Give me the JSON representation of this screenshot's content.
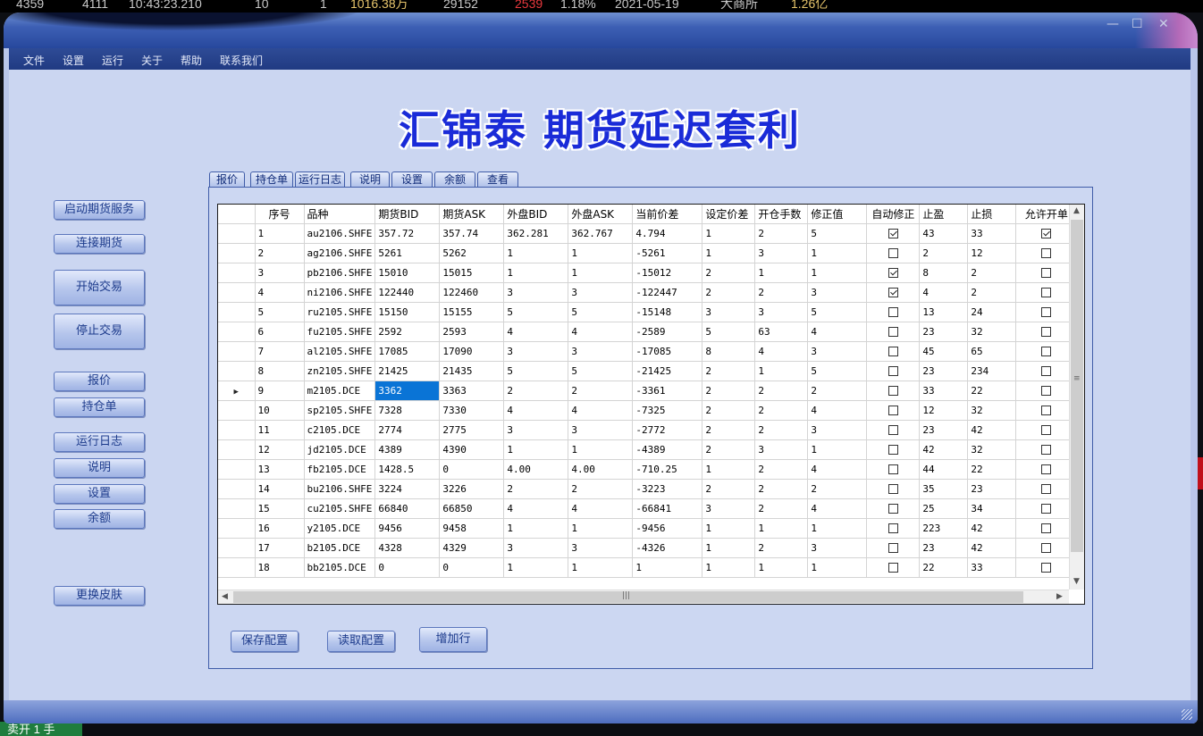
{
  "ticker": [
    "4359",
    "4111",
    "10:43:23.210",
    "10",
    "1",
    "1016.38万",
    "29152",
    "2539",
    "1.18%",
    "2021-05-19",
    "大商所",
    "1.26亿"
  ],
  "bottom_left_text": "卖开 1 手",
  "window": {
    "controls": {
      "minimize": "—",
      "maximize": "☐",
      "close": "✕"
    }
  },
  "menu": [
    "文件",
    "设置",
    "运行",
    "关于",
    "帮助",
    "联系我们"
  ],
  "app_title": "汇锦泰  期货延迟套利",
  "side_buttons": {
    "start_service": "启动期货服务",
    "connect": "连接期货",
    "start_trade": "开始交易",
    "stop_trade": "停止交易",
    "quote": "报价",
    "positions": "持仓单",
    "log": "运行日志",
    "about": "说明",
    "settings": "设置",
    "balance": "余额",
    "skin": "更换皮肤"
  },
  "tabs": [
    "报价",
    "持仓单",
    "运行日志",
    "说明",
    "设置",
    "余额",
    "查看"
  ],
  "grid": {
    "columns": [
      "",
      "序号",
      "品种",
      "期货BID",
      "期货ASK",
      "外盘BID",
      "外盘ASK",
      "当前价差",
      "设定价差",
      "开仓手数",
      "修正值",
      "自动修正",
      "止盈",
      "止损",
      "允许开单"
    ],
    "current_row_index": 8,
    "selected_cell": {
      "row": 8,
      "col": 3
    },
    "rows": [
      {
        "no": "1",
        "symbol": "au2106.SHFE",
        "fbid": "357.72",
        "fask": "357.74",
        "obid": "362.281",
        "oask": "362.767",
        "spread": "4.794",
        "setspread": "1",
        "lots": "2",
        "adj": "5",
        "auto": true,
        "tp": "43",
        "sl": "33",
        "allow": true
      },
      {
        "no": "2",
        "symbol": "ag2106.SHFE",
        "fbid": "5261",
        "fask": "5262",
        "obid": "1",
        "oask": "1",
        "spread": "-5261",
        "setspread": "1",
        "lots": "3",
        "adj": "1",
        "auto": false,
        "tp": "2",
        "sl": "12",
        "allow": false
      },
      {
        "no": "3",
        "symbol": "pb2106.SHFE",
        "fbid": "15010",
        "fask": "15015",
        "obid": "1",
        "oask": "1",
        "spread": "-15012",
        "setspread": "2",
        "lots": "1",
        "adj": "1",
        "auto": true,
        "tp": "8",
        "sl": "2",
        "allow": false
      },
      {
        "no": "4",
        "symbol": "ni2106.SHFE",
        "fbid": "122440",
        "fask": "122460",
        "obid": "3",
        "oask": "3",
        "spread": "-122447",
        "setspread": "2",
        "lots": "2",
        "adj": "3",
        "auto": true,
        "tp": "4",
        "sl": "2",
        "allow": false
      },
      {
        "no": "5",
        "symbol": "ru2105.SHFE",
        "fbid": "15150",
        "fask": "15155",
        "obid": "5",
        "oask": "5",
        "spread": "-15148",
        "setspread": "3",
        "lots": "3",
        "adj": "5",
        "auto": false,
        "tp": "13",
        "sl": "24",
        "allow": false
      },
      {
        "no": "6",
        "symbol": "fu2105.SHFE",
        "fbid": "2592",
        "fask": "2593",
        "obid": "4",
        "oask": "4",
        "spread": "-2589",
        "setspread": "5",
        "lots": "63",
        "adj": "4",
        "auto": false,
        "tp": "23",
        "sl": "32",
        "allow": false
      },
      {
        "no": "7",
        "symbol": "al2105.SHFE",
        "fbid": "17085",
        "fask": "17090",
        "obid": "3",
        "oask": "3",
        "spread": "-17085",
        "setspread": "8",
        "lots": "4",
        "adj": "3",
        "auto": false,
        "tp": "45",
        "sl": "65",
        "allow": false
      },
      {
        "no": "8",
        "symbol": "zn2105.SHFE",
        "fbid": "21425",
        "fask": "21435",
        "obid": "5",
        "oask": "5",
        "spread": "-21425",
        "setspread": "2",
        "lots": "1",
        "adj": "5",
        "auto": false,
        "tp": "23",
        "sl": "234",
        "allow": false
      },
      {
        "no": "9",
        "symbol": "m2105.DCE",
        "fbid": "3362",
        "fask": "3363",
        "obid": "2",
        "oask": "2",
        "spread": "-3361",
        "setspread": "2",
        "lots": "2",
        "adj": "2",
        "auto": false,
        "tp": "33",
        "sl": "22",
        "allow": false
      },
      {
        "no": "10",
        "symbol": "sp2105.SHFE",
        "fbid": "7328",
        "fask": "7330",
        "obid": "4",
        "oask": "4",
        "spread": "-7325",
        "setspread": "2",
        "lots": "2",
        "adj": "4",
        "auto": false,
        "tp": "12",
        "sl": "32",
        "allow": false
      },
      {
        "no": "11",
        "symbol": "c2105.DCE",
        "fbid": "2774",
        "fask": "2775",
        "obid": "3",
        "oask": "3",
        "spread": "-2772",
        "setspread": "2",
        "lots": "2",
        "adj": "3",
        "auto": false,
        "tp": "23",
        "sl": "42",
        "allow": false
      },
      {
        "no": "12",
        "symbol": "jd2105.DCE",
        "fbid": "4389",
        "fask": "4390",
        "obid": "1",
        "oask": "1",
        "spread": "-4389",
        "setspread": "2",
        "lots": "3",
        "adj": "1",
        "auto": false,
        "tp": "42",
        "sl": "32",
        "allow": false
      },
      {
        "no": "13",
        "symbol": "fb2105.DCE",
        "fbid": "1428.5",
        "fask": "0",
        "obid": "4.00",
        "oask": "4.00",
        "spread": "-710.25",
        "setspread": "1",
        "lots": "2",
        "adj": "4",
        "auto": false,
        "tp": "44",
        "sl": "22",
        "allow": false
      },
      {
        "no": "14",
        "symbol": "bu2106.SHFE",
        "fbid": "3224",
        "fask": "3226",
        "obid": "2",
        "oask": "2",
        "spread": "-3223",
        "setspread": "2",
        "lots": "2",
        "adj": "2",
        "auto": false,
        "tp": "35",
        "sl": "23",
        "allow": false
      },
      {
        "no": "15",
        "symbol": "cu2105.SHFE",
        "fbid": "66840",
        "fask": "66850",
        "obid": "4",
        "oask": "4",
        "spread": "-66841",
        "setspread": "3",
        "lots": "2",
        "adj": "4",
        "auto": false,
        "tp": "25",
        "sl": "34",
        "allow": false
      },
      {
        "no": "16",
        "symbol": "y2105.DCE",
        "fbid": "9456",
        "fask": "9458",
        "obid": "1",
        "oask": "1",
        "spread": "-9456",
        "setspread": "1",
        "lots": "1",
        "adj": "1",
        "auto": false,
        "tp": "223",
        "sl": "42",
        "allow": false
      },
      {
        "no": "17",
        "symbol": "b2105.DCE",
        "fbid": "4328",
        "fask": "4329",
        "obid": "3",
        "oask": "3",
        "spread": "-4326",
        "setspread": "1",
        "lots": "2",
        "adj": "3",
        "auto": false,
        "tp": "23",
        "sl": "42",
        "allow": false
      },
      {
        "no": "18",
        "symbol": "bb2105.DCE",
        "fbid": "0",
        "fask": "0",
        "obid": "1",
        "oask": "1",
        "spread": "1",
        "setspread": "1",
        "lots": "1",
        "adj": "1",
        "auto": false,
        "tp": "22",
        "sl": "33",
        "allow": false
      }
    ]
  },
  "panel_buttons": {
    "save": "保存配置",
    "load": "读取配置",
    "add_row": "增加行"
  },
  "colors": {
    "title_text": "#1a2bd8",
    "selection": "#0a74d6",
    "ticker_red": "#e8383d",
    "ticker_gold": "#e6c46b"
  }
}
